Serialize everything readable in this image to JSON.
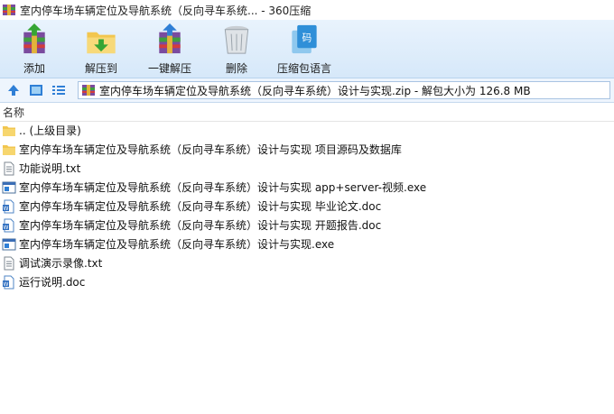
{
  "window": {
    "title": "室内停车场车辆定位及导航系统（反向寻车系统... - 360压缩"
  },
  "toolbar": {
    "add_label": "添加",
    "extract_label": "解压到",
    "one_click_label": "一键解压",
    "delete_label": "删除",
    "info_label": "压缩包语言"
  },
  "address": {
    "path": "室内停车场车辆定位及导航系统（反向寻车系统）设计与实现.zip - 解包大小为 126.8 MB"
  },
  "list": {
    "column_name": "名称",
    "items": [
      {
        "name": ".. (上级目录)",
        "icon": "folder-icon"
      },
      {
        "name": "室内停车场车辆定位及导航系统（反向寻车系统）设计与实现 项目源码及数据库",
        "icon": "folder-icon"
      },
      {
        "name": "功能说明.txt",
        "icon": "txt-file-icon"
      },
      {
        "name": "室内停车场车辆定位及导航系统（反向寻车系统）设计与实现 app+server-视频.exe",
        "icon": "exe-file-icon"
      },
      {
        "name": "室内停车场车辆定位及导航系统（反向寻车系统）设计与实现 毕业论文.doc",
        "icon": "doc-file-icon"
      },
      {
        "name": "室内停车场车辆定位及导航系统（反向寻车系统）设计与实现 开题报告.doc",
        "icon": "doc-file-icon"
      },
      {
        "name": "室内停车场车辆定位及导航系统（反向寻车系统）设计与实现.exe",
        "icon": "exe-file-icon"
      },
      {
        "name": "调试演示录像.txt",
        "icon": "txt-file-icon"
      },
      {
        "name": "运行说明.doc",
        "icon": "doc-file-icon"
      }
    ]
  }
}
